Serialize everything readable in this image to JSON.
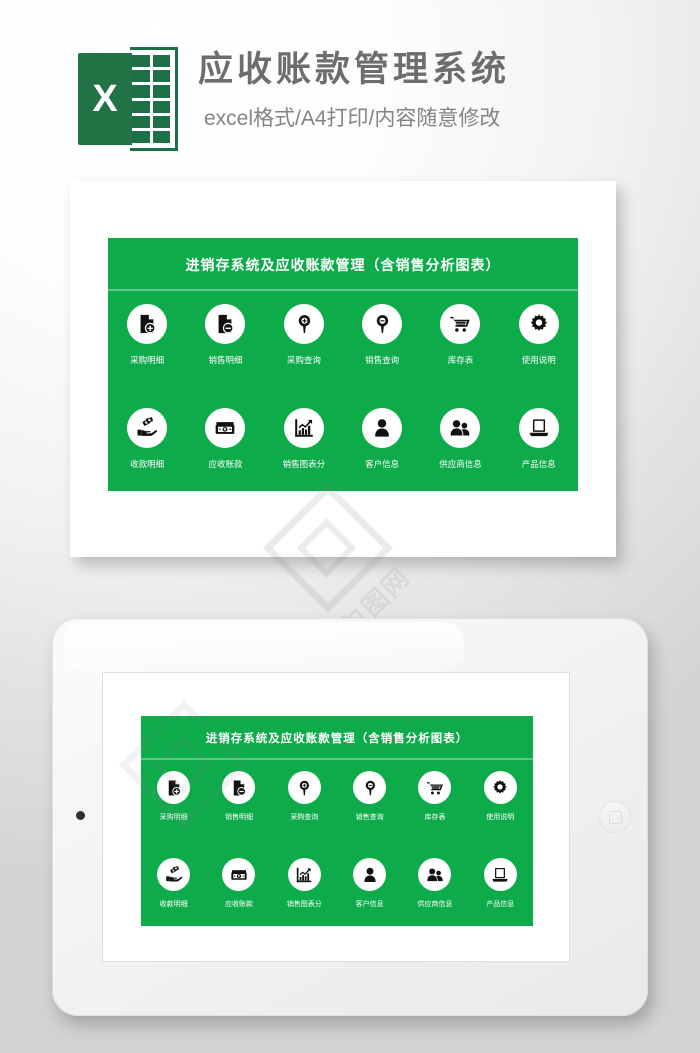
{
  "header": {
    "logo_letter": "X",
    "logo_name": "excel-logo",
    "title": "应收账款管理系统",
    "subtitle": "excel格式/A4打印/内容随意修改"
  },
  "colors": {
    "brand_green": "#0eab4b",
    "excel_green": "#217346",
    "rule_green": "#5ec68c",
    "title_gray": "#6d6d6d",
    "subtitle_gray": "#848484"
  },
  "panel": {
    "title": "进销存系统及应收账款管理（含销售分析图表）",
    "rows": [
      [
        {
          "label": "采购明细",
          "icon": "document-plus-icon"
        },
        {
          "label": "销售明细",
          "icon": "document-minus-icon"
        },
        {
          "label": "采购查询",
          "icon": "magnifier-plus-icon"
        },
        {
          "label": "销售查询",
          "icon": "magnifier-minus-icon"
        },
        {
          "label": "库存表",
          "icon": "shopping-cart-icon"
        },
        {
          "label": "使用说明",
          "icon": "gear-icon"
        }
      ],
      [
        {
          "label": "收款明细",
          "icon": "hand-money-icon"
        },
        {
          "label": "应收账款",
          "icon": "cash-stack-icon"
        },
        {
          "label": "销售图表分",
          "icon": "bar-chart-trend-icon"
        },
        {
          "label": "客户信息",
          "icon": "person-icon"
        },
        {
          "label": "供应商信息",
          "icon": "people-group-icon"
        },
        {
          "label": "产品信息",
          "icon": "laptop-icon"
        }
      ]
    ]
  },
  "watermark": {
    "text": "包图网"
  }
}
